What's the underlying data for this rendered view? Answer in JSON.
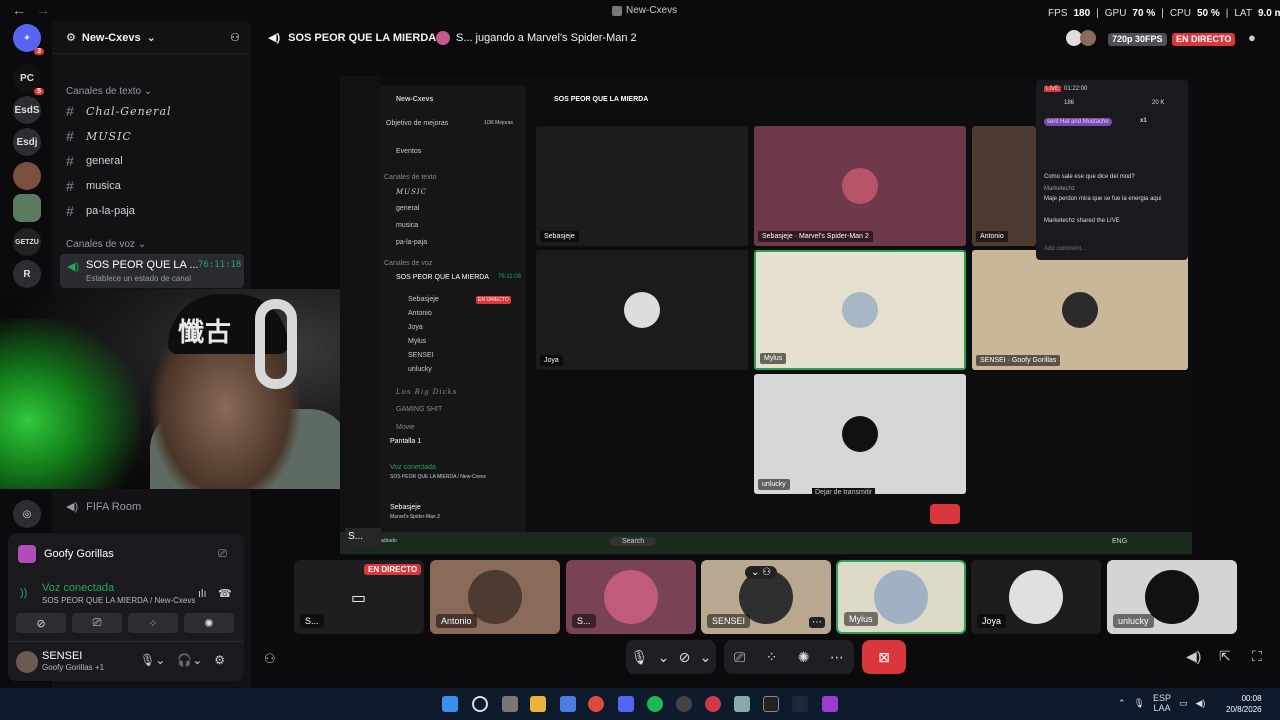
{
  "window": {
    "title": "New-Cxevs",
    "back": "←",
    "forward": "→"
  },
  "perf": {
    "fps_label": "FPS",
    "fps": "180",
    "gpu_label": "GPU",
    "gpu": "70 %",
    "cpu_label": "CPU",
    "cpu": "50 %",
    "lat_label": "LAT",
    "lat": "9.0 ms"
  },
  "rail": {
    "badge1": "3",
    "badge2": "5",
    "s1": "EsdS",
    "s2": "Esdj",
    "s3": "GETZU",
    "s4": "R"
  },
  "sidebar": {
    "server_name": "New-Cxevs",
    "text_category": "Canales de texto",
    "text_channels": [
      "Chal-General",
      "MUSIC",
      "general",
      "musica",
      "pa-la-paja"
    ],
    "voice_category": "Canales de voz",
    "active_voice": {
      "name": "SOS PEOR QUE LA ...",
      "time": "76:11:18",
      "status": "Establece un estado de canal"
    },
    "fifa": "FIFA Room"
  },
  "panel": {
    "activity": "Goofy Gorillas",
    "voice_connected": "Voz conectada",
    "voice_path": "SOS PEOR QUE LA MIERDA / New-Cxevs",
    "user": "SENSEI",
    "user_status": "Goofy Gorillas",
    "user_extra": "+1"
  },
  "header": {
    "channel": "SOS PEOR QUE LA MIERDA",
    "activity": "S... jugando a Marvel's Spider-Man 2",
    "quality": "720p 30FPS",
    "live": "EN DIRECTO"
  },
  "nested": {
    "server": "New-Cxevs",
    "channel": "SOS PEOR QUE LA MIERDA",
    "goal": "Objetivo de mejoras",
    "goal_val": "1/36 Mejoras",
    "events": "Eventos",
    "text_cat": "Canales de texto",
    "text_ch": [
      "MUSIC",
      "general",
      "musica",
      "pa-la-paja"
    ],
    "voice_cat": "Canales de voz",
    "voice_ch": "SOS PEOR QUE LA MIERDA",
    "voice_time": "76:11:08",
    "members": [
      "Sebasjeje",
      "Antonio",
      "Joya",
      "Mylus",
      "SENSEI",
      "unlucky"
    ],
    "live": "EN DIRECTO",
    "other_ch": [
      "Los Big Dicks",
      "GAMING SHIT",
      "Movie"
    ],
    "screen": "Pantalla 1",
    "vc": "Voz conectada",
    "vc_path": "SOS PEOR QUE LA MIERDA / New-Cxevs",
    "user": "Sebasjeje",
    "user_sub": "Marvel's Spider-Man 2",
    "stop_tip": "Dejar de transmitir",
    "tiles": {
      "sebas": "Sebasjeje",
      "sebas_game": "Marvel's Spider-Man 2",
      "antonio": "Antonio",
      "joya": "Joya",
      "mylus": "Mylus",
      "sensei": "SENSEI",
      "sensei_game": "Goofy Gorillas",
      "unlucky": "unlucky"
    },
    "chat": {
      "live": "LIVE",
      "time": "01:22:00",
      "viewers": "186",
      "likes": "20 K",
      "gift": "sent Hat and Mustache",
      "gift_x": "x1",
      "msg1": "Como sale ese que dice del mod?",
      "user2": "Marketechz",
      "msg2": "Maje perdon mira que se fue la energia aqui",
      "share": "Marketechz shared the LIVE",
      "placeholder": "Add comment..."
    },
    "taskbar_search": "Search",
    "weather": "mayorm. nublado",
    "tb_lang": "ENG"
  },
  "bottom_tiles": [
    {
      "label": "S...",
      "badge": "EN DIRECTO"
    },
    {
      "label": "Antonio"
    },
    {
      "label": "S..."
    },
    {
      "label": "SENSEI"
    },
    {
      "label": "Mylus"
    },
    {
      "label": "Joya"
    },
    {
      "label": "unlucky"
    }
  ],
  "taskbar": {
    "lang1": "ESP",
    "lang2": "LAA",
    "time": "00:08",
    "date": "20/8/2026"
  },
  "colors": {
    "accent_green": "#23a55a",
    "live_red": "#da373c",
    "brand_blue": "#5865f2"
  }
}
